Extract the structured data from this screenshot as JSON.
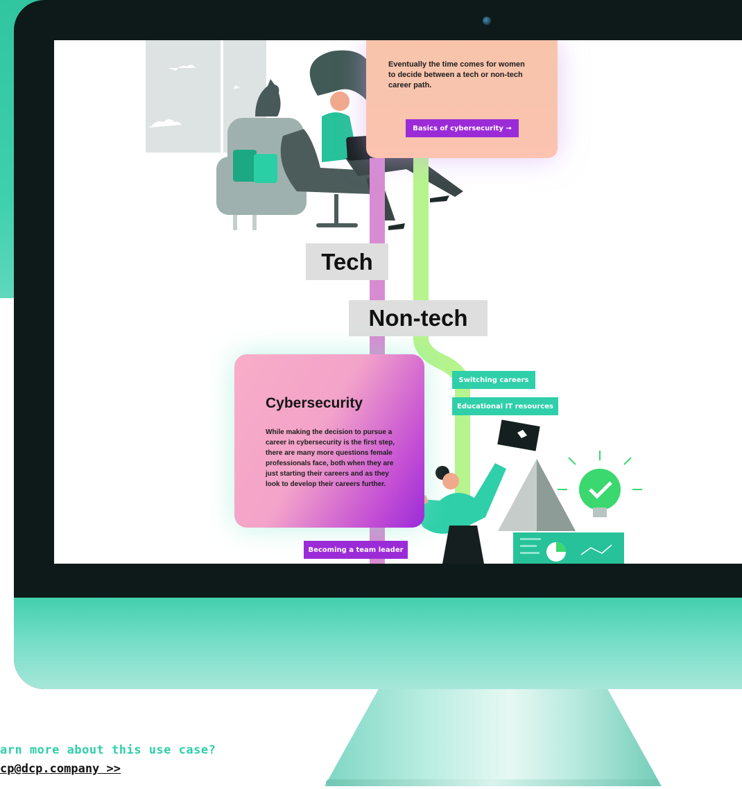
{
  "screen": {
    "top_card": {
      "text": "Eventually the time comes for women to decide between a tech or non-tech career path.",
      "button_label": "Basics of cybersecurity →"
    },
    "branch_labels": {
      "tech": "Tech",
      "non_tech": "Non-tech"
    },
    "cyber_card": {
      "title": "Cybersecurity",
      "text": "While making the decision to pursue a career in cybersecurity is the first step, there are many more questions female professionals face, both when they are just starting their careers and as they look to develop their careers further.",
      "button_label": "Becoming a team leader"
    },
    "side_buttons": {
      "switching": "Switching careers",
      "educational": "Educational IT resources"
    }
  },
  "footer": {
    "question": "arn more about this use case?",
    "email_link": "cp@dcp.company >>"
  },
  "colors": {
    "purple_button": "#9b2bd7",
    "teal_button": "#2fcfa9",
    "pink_path": "#d78cd1",
    "green_path": "#b6f48d",
    "label_gray": "#dedede"
  }
}
